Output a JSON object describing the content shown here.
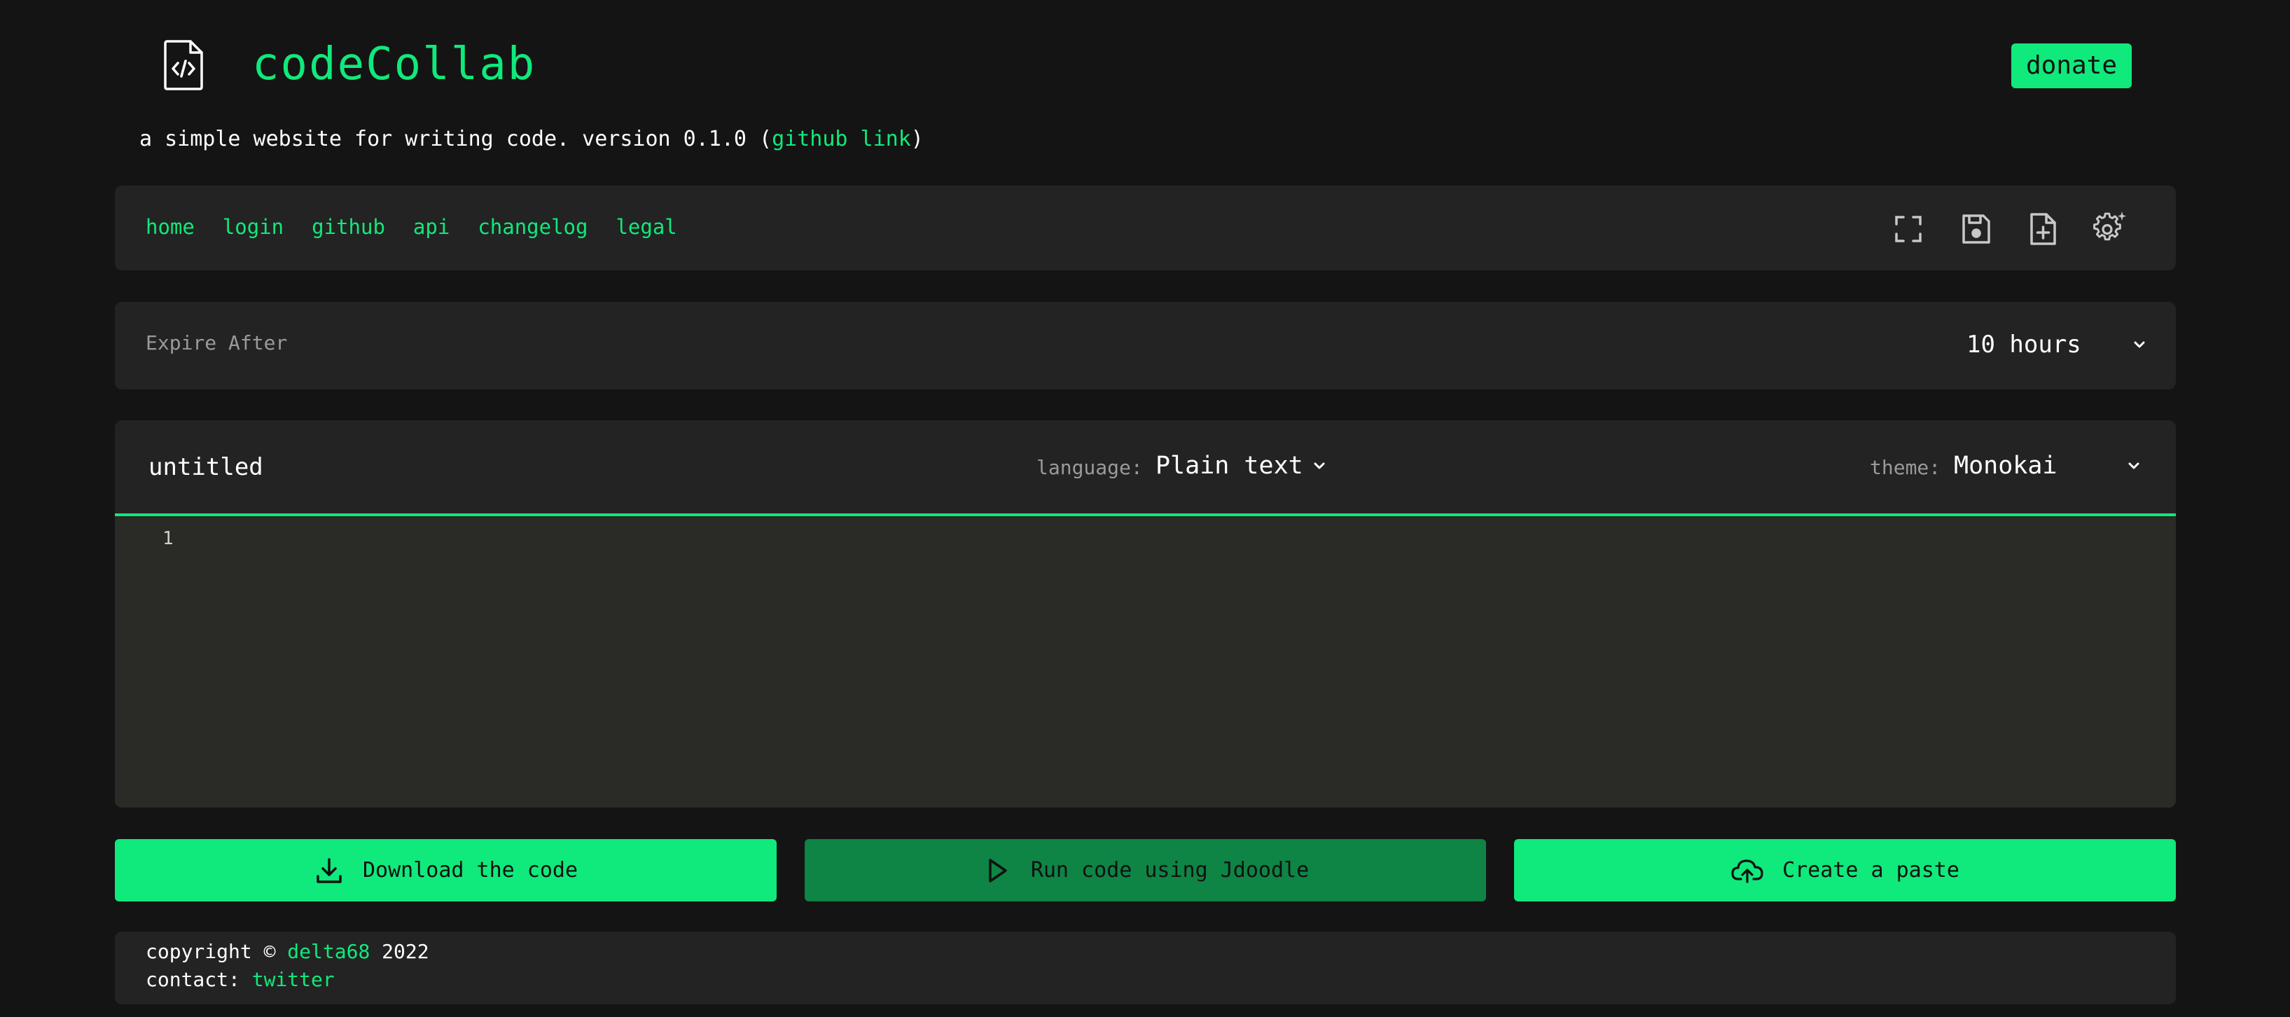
{
  "header": {
    "app_title": "codeCollab",
    "donate_label": "donate",
    "logo_icon": "file-code-icon"
  },
  "tagline": {
    "text": "a simple website for writing code. version 0.1.0 (",
    "link": "github link",
    "close": ")"
  },
  "nav": {
    "links": [
      "home",
      "login",
      "github",
      "api",
      "changelog",
      "legal"
    ],
    "tools": [
      "fullscreen-icon",
      "save-icon",
      "new-file-icon",
      "settings-icon"
    ]
  },
  "expire": {
    "label": "Expire After",
    "value": "10 hours"
  },
  "editor": {
    "filename": "untitled",
    "language_label": "language:",
    "language_value": "Plain text",
    "theme_label": "theme:",
    "theme_value": "Monokai",
    "line_numbers": [
      "1"
    ]
  },
  "actions": {
    "download": "Download the code",
    "run": "Run code using Jdoodle",
    "paste": "Create a paste"
  },
  "footer": {
    "copyright_prefix": "copyright © ",
    "copyright_link": "delta68",
    "copyright_year": " 2022",
    "contact_prefix": "contact: ",
    "contact_link": "twitter"
  },
  "colors": {
    "accent": "#10e97b",
    "accent_dark": "#0e8445",
    "background": "#141414",
    "panel": "#232323",
    "editor_bg": "#2a2a26"
  }
}
